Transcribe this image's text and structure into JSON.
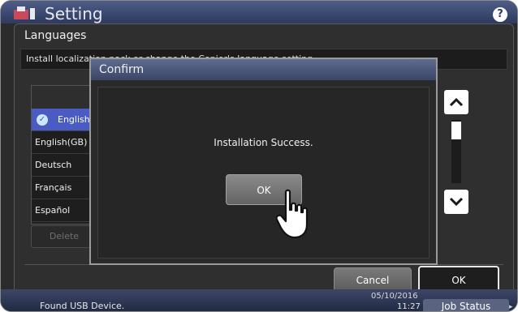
{
  "header": {
    "title": "Setting",
    "help_label": "?"
  },
  "languages_panel": {
    "title": "Languages",
    "info_text": "Install localization pack or change the Copier's language setting.",
    "list": [
      {
        "label": "English",
        "selected": true
      },
      {
        "label": "English(GB)",
        "selected": false
      },
      {
        "label": "Deutsch",
        "selected": false
      },
      {
        "label": "Français",
        "selected": false
      },
      {
        "label": "Español",
        "selected": false
      }
    ],
    "delete_label": "Delete",
    "cancel_label": "Cancel",
    "ok_label": "OK"
  },
  "confirm_dialog": {
    "title": "Confirm",
    "message": "Installation Success.",
    "ok_label": "OK"
  },
  "status_bar": {
    "message": "Found USB Device.",
    "date": "05/10/2016",
    "time": "11:27",
    "job_status_label": "Job Status"
  },
  "icons": {
    "logo": "setting-logo-icon",
    "check": "check-icon",
    "scroll_up": "chevron-up-icon",
    "scroll_down": "chevron-down-icon",
    "pointer": "hand-pointer-icon"
  },
  "colors": {
    "selected_row": "#4a5cc4",
    "title_bar": "#4e5d87",
    "dialog_title_bar": "#5e6c90"
  }
}
